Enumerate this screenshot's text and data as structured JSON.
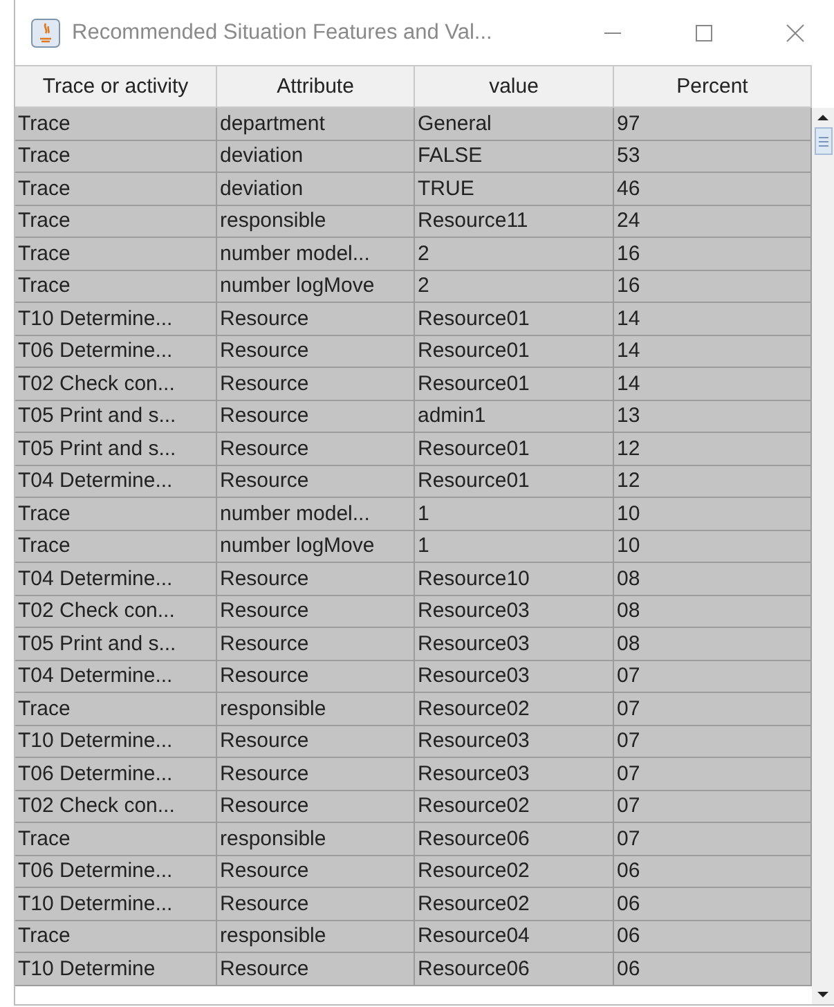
{
  "window": {
    "title": "Recommended Situation Features and Val..."
  },
  "table": {
    "columns": [
      "Trace or activity",
      "Attribute",
      "value",
      "Percent"
    ],
    "rows": [
      [
        "Trace",
        "department",
        "General",
        "97"
      ],
      [
        "Trace",
        "deviation",
        "FALSE",
        "53"
      ],
      [
        "Trace",
        "deviation",
        "TRUE",
        "46"
      ],
      [
        "Trace",
        "responsible",
        "Resource11",
        "24"
      ],
      [
        "Trace",
        "number model...",
        "2",
        "16"
      ],
      [
        "Trace",
        "number logMove",
        "2",
        "16"
      ],
      [
        "T10 Determine...",
        "Resource",
        "Resource01",
        "14"
      ],
      [
        "T06 Determine...",
        "Resource",
        "Resource01",
        "14"
      ],
      [
        "T02 Check con...",
        "Resource",
        "Resource01",
        "14"
      ],
      [
        "T05 Print and s...",
        "Resource",
        "admin1",
        "13"
      ],
      [
        "T05 Print and s...",
        "Resource",
        "Resource01",
        "12"
      ],
      [
        "T04 Determine...",
        "Resource",
        "Resource01",
        "12"
      ],
      [
        "Trace",
        "number model...",
        "1",
        "10"
      ],
      [
        "Trace",
        "number logMove",
        "1",
        "10"
      ],
      [
        "T04 Determine...",
        "Resource",
        "Resource10",
        "08"
      ],
      [
        "T02 Check con...",
        "Resource",
        "Resource03",
        "08"
      ],
      [
        "T05 Print and s...",
        "Resource",
        "Resource03",
        "08"
      ],
      [
        "T04 Determine...",
        "Resource",
        "Resource03",
        "07"
      ],
      [
        "Trace",
        "responsible",
        "Resource02",
        "07"
      ],
      [
        "T10 Determine...",
        "Resource",
        "Resource03",
        "07"
      ],
      [
        "T06 Determine...",
        "Resource",
        "Resource03",
        "07"
      ],
      [
        "T02 Check con...",
        "Resource",
        "Resource02",
        "07"
      ],
      [
        "Trace",
        "responsible",
        "Resource06",
        "07"
      ],
      [
        "T06 Determine...",
        "Resource",
        "Resource02",
        "06"
      ],
      [
        "T10 Determine...",
        "Resource",
        "Resource02",
        "06"
      ],
      [
        "Trace",
        "responsible",
        "Resource04",
        "06"
      ],
      [
        "T10 Determine",
        "Resource",
        "Resource06",
        "06"
      ]
    ]
  }
}
